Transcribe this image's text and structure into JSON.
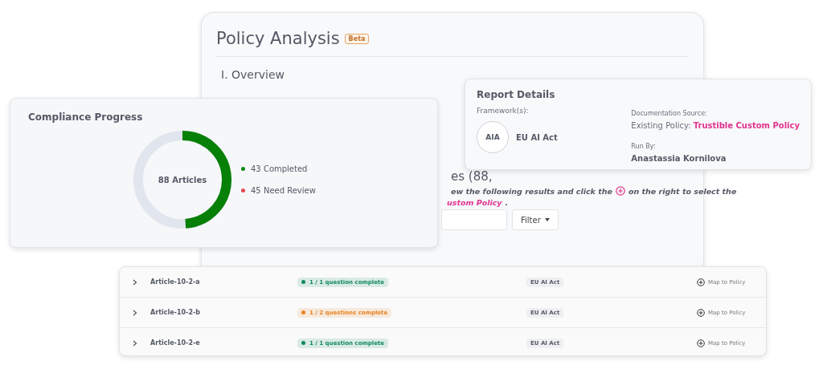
{
  "policy_analysis": {
    "title": "Policy Analysis",
    "badge": "Beta",
    "section": "I. Overview",
    "heading_fragment": "es (88,",
    "instructions_fragment": "ew the following results and click the",
    "instructions_after_icon": "on the right to select the",
    "policy_link_fragment": "ustom Policy",
    "instructions_end": ".",
    "filter_button": "Filter"
  },
  "compliance_progress": {
    "title": "Compliance Progress",
    "center_label": "88 Articles",
    "level": 0.489,
    "legend": [
      {
        "label": "43 Completed",
        "color": "#0a8a16"
      },
      {
        "label": "45 Need Review",
        "color": "#e5484d"
      }
    ]
  },
  "report_details": {
    "title": "Report Details",
    "framework_label": "Framework(s):",
    "framework_logo": "AIA",
    "framework": "EU AI Act",
    "source_label": "Documentation Source:",
    "source_prefix": "Existing Policy:",
    "source_link": "Trustible Custom Policy",
    "run_by_label": "Run By:",
    "run_by": "Anastassia Kornilova"
  },
  "articles": [
    {
      "name": "Article-10-2-a",
      "status": "1 / 1 question complete",
      "color": "#0f8a5f",
      "framework": "EU AI Act",
      "action": "Map to Policy",
      "expanded": false
    },
    {
      "name": "Article-10-2-b",
      "status": "1 / 2 questions complete",
      "color": "#e8821e",
      "framework": "EU AI Act",
      "action": "Map to Policy",
      "expanded": false
    },
    {
      "name": "Article-10-2-e",
      "status": "1 / 1 question complete",
      "color": "#0f8a5f",
      "framework": "EU AI Act",
      "action": "Map to Policy",
      "expanded": false
    }
  ]
}
